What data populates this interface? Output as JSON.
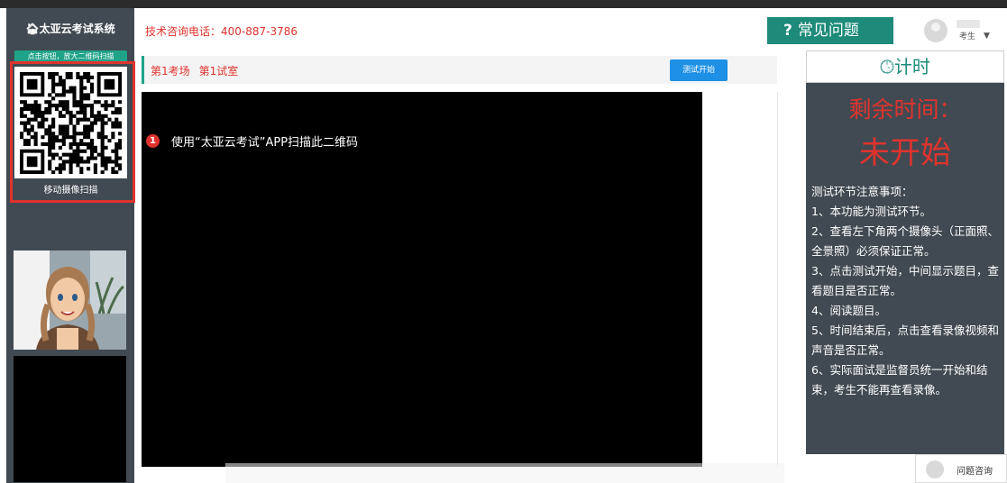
{
  "sidebar": {
    "app_title": "太亚云考试系统",
    "qr_button_label": "点击按钮，放大二维码扫描",
    "qr_caption": "移动摄像扫描"
  },
  "header": {
    "hotline": "技术咨询电话：400-887-3786",
    "faq_label": "常见问题",
    "user_role": "考生"
  },
  "room": {
    "exam_site": "第1考场",
    "exam_room": "第1试室",
    "start_button": "测试开始"
  },
  "main": {
    "notice_number": "1",
    "notice_text": "使用“太亚云考试”APP扫描此二维码"
  },
  "timer": {
    "title": "计时",
    "remaining_label": "剩余时间：",
    "remaining_value": "未开始",
    "notes_title": "测试环节注意事项：",
    "notes": [
      "1、本功能为测试环节。",
      "2、查看左下角两个摄像头（正面照、全景照）必须保证正常。",
      "3、点击测试开始，中间显示题目，查看题目是否正常。",
      "4、阅读题目。",
      "5、时间结束后，点击查看录像视频和声音是否正常。",
      "6、实际面试是监督员统一开始和结束，考生不能再查看录像。"
    ]
  },
  "consult": {
    "label": "问题咨询"
  },
  "colors": {
    "accent_green": "#1d8a7a",
    "alert_red": "#e0332e",
    "primary_blue": "#1e90e6",
    "sidebar_dark": "#414a52"
  }
}
